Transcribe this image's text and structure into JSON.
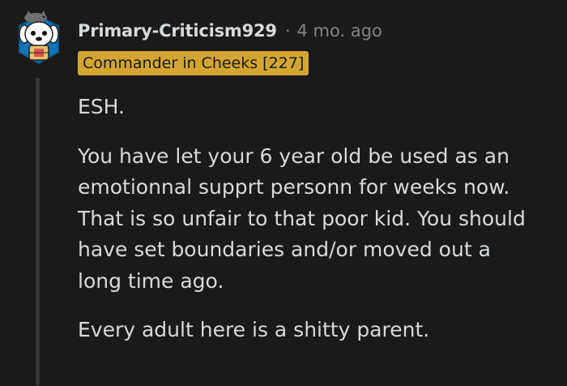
{
  "comment": {
    "author": "Primary-Criticism929",
    "separator": "·",
    "timestamp": "4 mo. ago",
    "flair": "Commander in Cheeks [227]",
    "avatar_icon": "snoo-dog-avatar-icon",
    "paragraphs": [
      "ESH.",
      "You have let your 6 year old be used as an\nemotionnal supprt personn for weeks now.\nThat is so unfair to that poor kid. You should\nhave set boundaries and/or moved out a\nlong time ago.",
      "Every adult here is a shitty parent."
    ]
  },
  "colors": {
    "background": "#1a1a1b",
    "text": "#d7dadc",
    "muted": "#818384",
    "flair_bg": "#d4a531",
    "thread_line": "#343536"
  }
}
